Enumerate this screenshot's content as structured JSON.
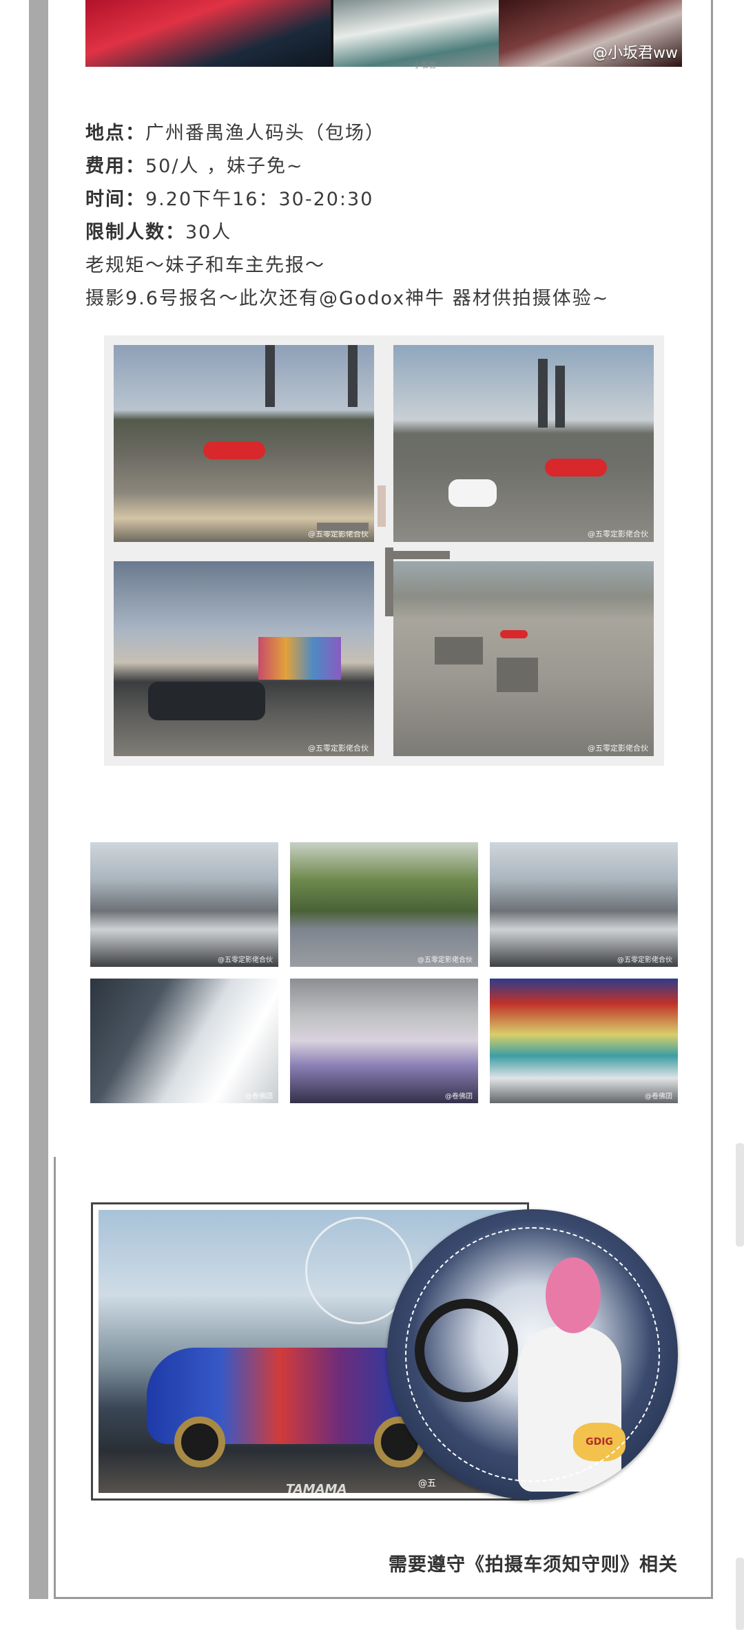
{
  "top_banner": {
    "watermark": "@小坂君ww",
    "watermark_small": "小坂君"
  },
  "info": {
    "location_label": "地点：",
    "location_value": "广州番禺渔人码头（包场）",
    "fee_label": "费用：",
    "fee_value": "50/人 ，妹子免~",
    "time_label": "时间：",
    "time_value": "9.20下午16：30-20:30",
    "limit_label": "限制人数：",
    "limit_value": "30人",
    "line5": "老规矩～妹子和车主先报～",
    "line6": "摄影9.6号报名～此次还有@Godox神牛 器材供拍摄体验~"
  },
  "collage": {
    "watermark": "@五零定影佬合伙"
  },
  "grid": {
    "watermark_a": "@五零定影佬合伙",
    "watermark_b": "@卷佛囝"
  },
  "feature": {
    "car_brand": "TAMAMA",
    "watermark": "@五",
    "badge": "GDIG"
  },
  "footer": {
    "note": "需要遵守《拍摄车须知守则》相关"
  }
}
